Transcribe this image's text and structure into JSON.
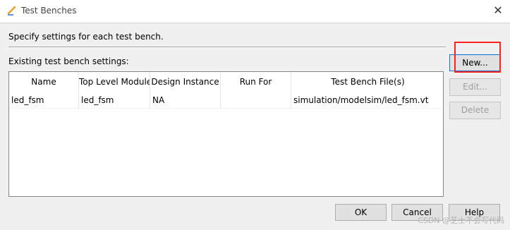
{
  "window": {
    "title": "Test Benches",
    "close_symbol": "✕"
  },
  "instruction": "Specify settings for each test bench.",
  "group_label": "Existing test bench settings:",
  "table": {
    "columns": [
      "Name",
      "Top Level Module",
      "Design Instance",
      "Run For",
      "Test Bench File(s)"
    ],
    "rows": [
      [
        "led_fsm",
        "led_fsm",
        "NA",
        "",
        "simulation/modelsim/led_fsm.vt"
      ]
    ]
  },
  "side_buttons": {
    "new": "New...",
    "edit": "Edit...",
    "delete": "Delete"
  },
  "footer_buttons": {
    "ok": "OK",
    "cancel": "Cancel",
    "help": "Help"
  },
  "watermark": "CSDN @芝士不会写代码",
  "colors": {
    "highlight": "#ff2020",
    "focus_border": "#0078d7"
  }
}
